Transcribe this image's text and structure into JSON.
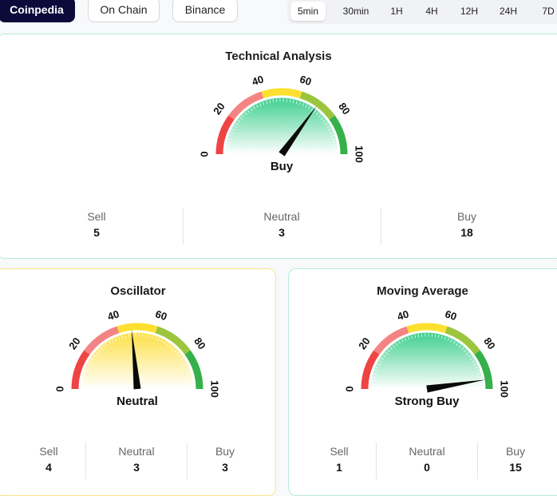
{
  "sources": [
    {
      "label": "Coinpedia",
      "active": true
    },
    {
      "label": "On Chain",
      "active": false
    },
    {
      "label": "Binance",
      "active": false
    }
  ],
  "timeframes": [
    {
      "label": "5min",
      "active": true
    },
    {
      "label": "30min",
      "active": false
    },
    {
      "label": "1H",
      "active": false
    },
    {
      "label": "4H",
      "active": false
    },
    {
      "label": "12H",
      "active": false
    },
    {
      "label": "24H",
      "active": false
    },
    {
      "label": "7D",
      "active": false
    }
  ],
  "technical": {
    "title": "Technical Analysis",
    "value": 70,
    "verdict": "Buy",
    "sell_label": "Sell",
    "sell": "5",
    "neutral_label": "Neutral",
    "neutral": "3",
    "buy_label": "Buy",
    "buy": "18"
  },
  "oscillator": {
    "title": "Oscillator",
    "value": 47,
    "verdict": "Neutral",
    "sell_label": "Sell",
    "sell": "4",
    "neutral_label": "Neutral",
    "neutral": "3",
    "buy_label": "Buy",
    "buy": "3"
  },
  "moving_average": {
    "title": "Moving Average",
    "value": 95,
    "verdict": "Strong Buy",
    "sell_label": "Sell",
    "sell": "1",
    "neutral_label": "Neutral",
    "neutral": "0",
    "buy_label": "Buy",
    "buy": "15"
  },
  "gauge_ticks": [
    "0",
    "20",
    "40",
    "60",
    "80",
    "100"
  ],
  "colors": {
    "seg_0_20": "#ef4444",
    "seg_20_40": "#f48484",
    "seg_40_60": "#fde02f",
    "seg_60_80": "#9bc53d",
    "seg_80_100": "#36b04a",
    "fill_green": "#3fcf8e",
    "fill_yellow": "#fde047",
    "card_green_border": "#b7ecd3",
    "card_yellow_border": "#fbe38a",
    "source_active_bg": "#0b0a3a"
  }
}
